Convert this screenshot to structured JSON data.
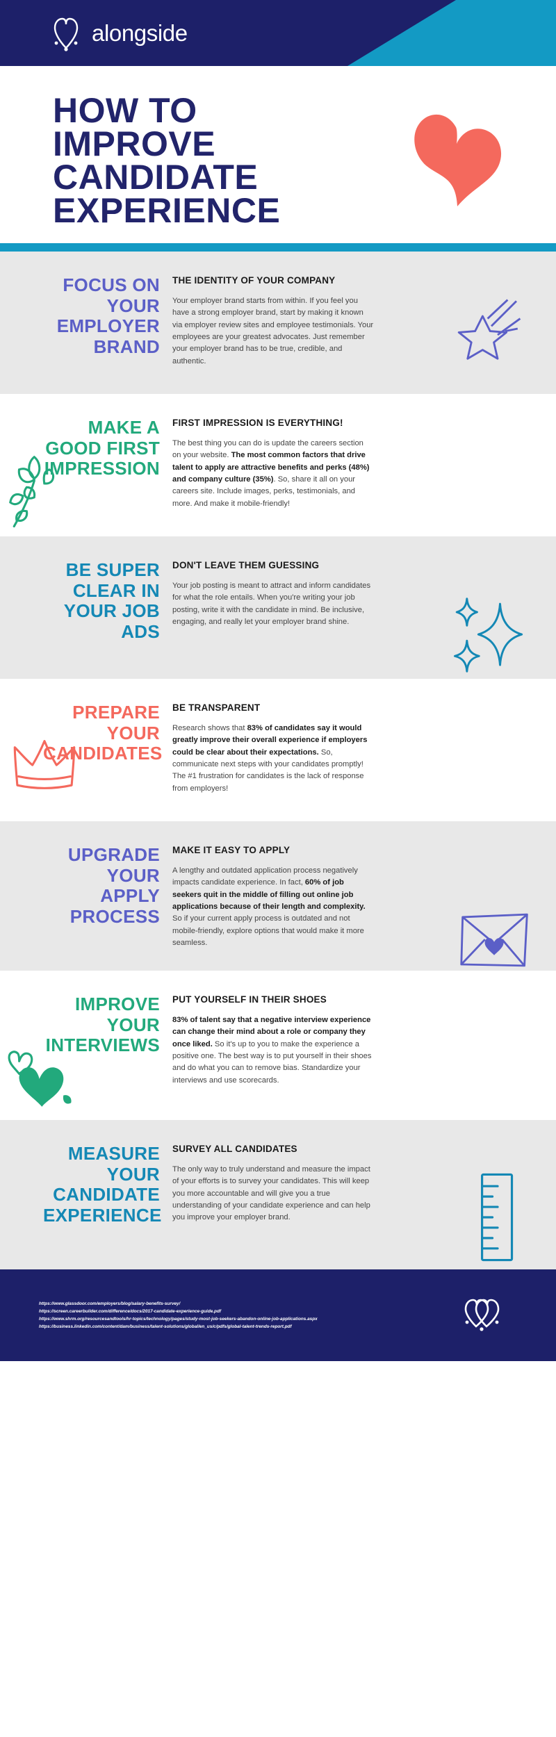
{
  "brand": {
    "name": "alongside",
    "logo_icon": "double-heart-logo-icon",
    "navy": "#1d2069",
    "cyan": "#139ac4",
    "coral": "#f4695d",
    "purple": "#5b5fc7",
    "green": "#22a97c",
    "blue": "#1488b5"
  },
  "hero": {
    "title": "HOW TO IMPROVE CANDIDATE EXPERIENCE",
    "art_icon": "heart-icon"
  },
  "sections": [
    {
      "title": "FOCUS ON YOUR EMPLOYER BRAND",
      "color": "#5b5fc7",
      "background": "shaded",
      "heading": "THE IDENTITY OF YOUR COMPANY",
      "body_html": "Your employer brand starts from within. If you feel you have a strong employer brand, start by making it known via employer review sites and employee testimonials. Your employees are your greatest advocates. Just remember your employer brand has to be true, credible, and authentic.",
      "art_icon": "shooting-star-icon"
    },
    {
      "title": "MAKE A GOOD FIRST IMPRESSION",
      "color": "#22a97c",
      "background": "plain",
      "heading": "FIRST IMPRESSION IS EVERYTHING!",
      "body_html": "The best thing you can do is update the careers section on your website. <b>The most common factors that drive talent to apply are attractive benefits and perks (48%) and company culture (35%)</b>. So, share it all on your careers site. Include images, perks, testimonials, and more. And make it mobile-friendly!",
      "art_icon": "flower-icon"
    },
    {
      "title": "BE SUPER CLEAR IN YOUR JOB ADS",
      "color": "#1488b5",
      "background": "shaded",
      "heading": "DON'T LEAVE THEM GUESSING",
      "body_html": "Your job posting is meant to attract and inform candidates for what the role entails. When you're writing your job posting, write it with the candidate in mind. Be inclusive, engaging, and really let your employer brand shine.",
      "art_icon": "sparkles-icon"
    },
    {
      "title": "PREPARE YOUR CANDIDATES",
      "color": "#f4695d",
      "background": "plain",
      "heading": "BE TRANSPARENT",
      "body_html": "Research shows that <b>83% of candidates say it would greatly improve their overall experience if employers could be clear about their expectations.</b> So, communicate next steps with your candidates promptly! The #1 frustration for candidates is the lack of response from employers!",
      "art_icon": "crown-icon"
    },
    {
      "title": "UPGRADE YOUR APPLY PROCESS",
      "color": "#5b5fc7",
      "background": "shaded",
      "heading": "MAKE IT EASY TO APPLY",
      "body_html": "A lengthy and outdated application process negatively impacts candidate experience. In fact, <b>60% of job seekers quit in the middle of filling out online job applications because of their length and complexity.</b> So if your current apply process is outdated and not mobile-friendly, explore options that would make it more seamless.",
      "art_icon": "envelope-heart-icon"
    },
    {
      "title": "IMPROVE YOUR INTERVIEWS",
      "color": "#22a97c",
      "background": "plain",
      "heading": "PUT YOURSELF IN THEIR SHOES",
      "body_html": "<b>83% of talent say that a negative interview experience can change their mind about a role or company they once liked.</b> So it's up to you to make the experience a positive one. The best way is to put yourself in their shoes and do what you can to remove bias. Standardize your interviews and use scorecards.",
      "art_icon": "double-heart-icon"
    },
    {
      "title": "MEASURE YOUR CANDIDATE EXPERIENCE",
      "color": "#1488b5",
      "background": "shaded",
      "heading": "SURVEY ALL CANDIDATES",
      "body_html": "The only way to truly understand and measure the impact of your efforts is to survey your candidates. This will keep you more accountable and will give you a true understanding of your candidate experience and can help you improve your employer brand.",
      "art_icon": "ruler-icon"
    }
  ],
  "footer": {
    "links": [
      "https://www.glassdoor.com/employers/blog/salary-benefits-survey/",
      "https://screen.careerbuilder.com/difference/docs/2017-candidate-experience-guide.pdf",
      "https://www.shrm.org/resourcesandtools/hr-topics/technology/pages/study-most-job-seekers-abandon-online-job-applications.aspx",
      "https://business.linkedin.com/content/dam/business/talent-solutions/global/en_us/c/pdfs/global-talent-trends-report.pdf"
    ],
    "logo_icon": "double-heart-logo-icon"
  }
}
